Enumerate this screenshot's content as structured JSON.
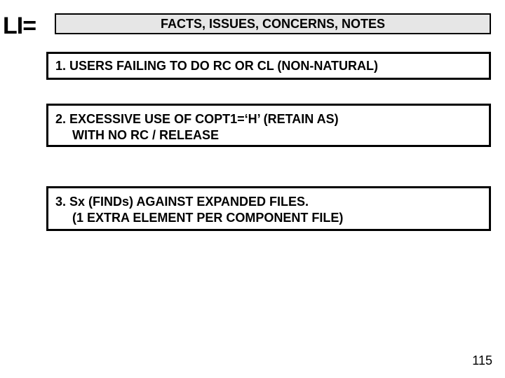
{
  "header": {
    "top_left": "LI=",
    "title": "FACTS, ISSUES, CONCERNS, NOTES"
  },
  "boxes": {
    "b1_line": "1. USERS FAILING TO DO  RC OR CL (NON-NATURAL)",
    "b2_line1": "2. EXCESSIVE USE OF COPT1=‘H’  (RETAIN AS)",
    "b2_line2": "WITH NO RC / RELEASE",
    "b3_line1": "3. Sx (FINDs) AGAINST EXPANDED FILES.",
    "b3_line2": "(1 EXTRA ELEMENT PER COMPONENT FILE)"
  },
  "page_number": "115"
}
